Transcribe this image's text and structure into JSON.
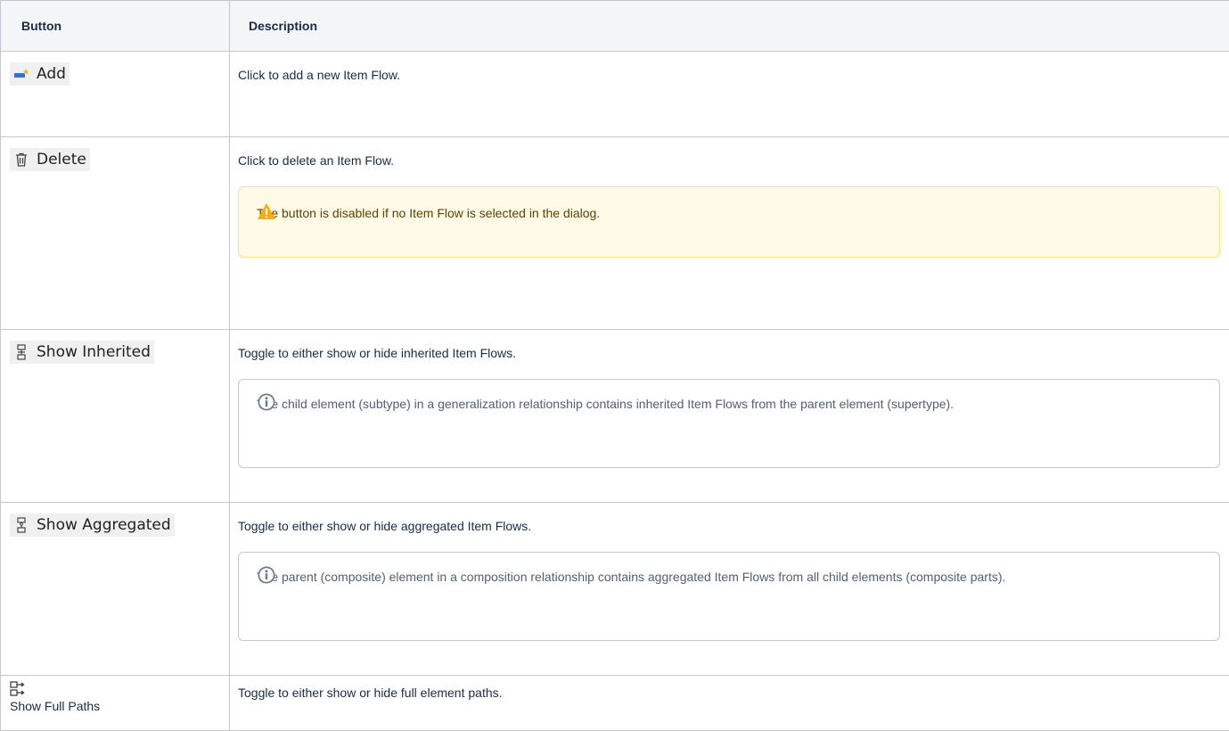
{
  "table": {
    "header": {
      "col1": "Button",
      "col2": "Description"
    },
    "rows": {
      "add": {
        "button": "Add",
        "icon": "add-icon",
        "description": "Click to add a new Item Flow."
      },
      "delete": {
        "button": "Delete",
        "icon": "trash-icon",
        "description": "Click to delete an Item Flow.",
        "note": {
          "type": "warning",
          "icon": "warning-icon",
          "text": "The button is disabled if no Item Flow is selected in the dialog."
        }
      },
      "inherited": {
        "button": "Show Inherited",
        "icon": "hierarchy-icon",
        "description": "Toggle to either show or hide inherited Item Flows.",
        "note": {
          "type": "info",
          "icon": "info-icon",
          "text": "The child element (subtype) in a generalization relationship contains inherited Item Flows from the parent element (supertype)."
        }
      },
      "aggregated": {
        "button": "Show Aggregated",
        "icon": "aggregate-icon",
        "description": "Toggle to either show or hide aggregated Item Flows.",
        "note": {
          "type": "info",
          "icon": "info-icon",
          "text": "The parent (composite) element in a composition relationship contains aggregated Item Flows from all child elements (composite parts)."
        }
      },
      "fullpaths": {
        "button": "Show Full Paths",
        "icon": "full-paths-icon",
        "description": "Toggle to either show or hide full element paths."
      }
    }
  },
  "colors": {
    "warning_bg": "#fffae6",
    "warning_border": "#ffe380",
    "info_border": "#c1c7d0",
    "header_bg": "#f4f5f7"
  }
}
